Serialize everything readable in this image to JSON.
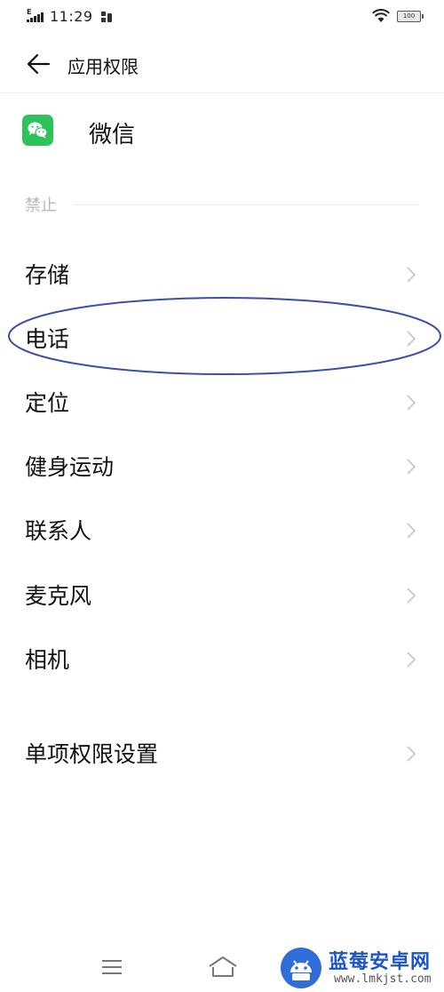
{
  "status_bar": {
    "network_type": "E",
    "time": "11:29",
    "battery_level": "100"
  },
  "header": {
    "title": "应用权限",
    "back_icon": "arrow-left-icon"
  },
  "app": {
    "name": "微信",
    "icon": "wechat-icon",
    "icon_color": "#2ec35a"
  },
  "section": {
    "label": "禁止"
  },
  "permissions": [
    {
      "label": "存储"
    },
    {
      "label": "电话"
    },
    {
      "label": "定位"
    },
    {
      "label": "健身运动"
    },
    {
      "label": "联系人"
    },
    {
      "label": "麦克风"
    },
    {
      "label": "相机"
    }
  ],
  "individual_settings": {
    "label": "单项权限设置"
  },
  "annotation": {
    "color": "#3b4fa8",
    "highlighted_item": "电话"
  },
  "navbar": {
    "menu_icon": "menu-icon",
    "home_icon": "home-icon"
  },
  "watermark": {
    "title": "蓝莓安卓网",
    "url": "www.lmkjst.com"
  }
}
